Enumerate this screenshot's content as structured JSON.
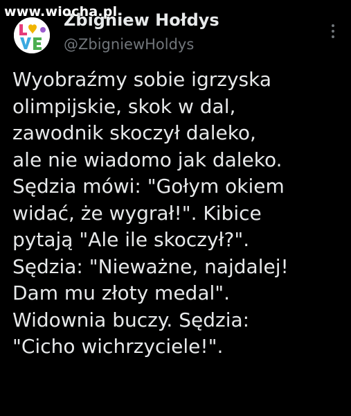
{
  "watermark": "www.wiocha.pl",
  "author": {
    "name": "Zbigniew Hołdys",
    "handle": "@ZbigniewHoldys",
    "avatar_text": "LOVE"
  },
  "menu_icon": "more-vertical-icon",
  "tweet": {
    "lines": [
      "Wyobraźmy sobie igrzyska",
      "olimpijskie, skok w dal,",
      "zawodnik skoczył daleko,",
      "ale nie wiadomo jak daleko.",
      "Sędzia mówi: \"Gołym okiem",
      "widać, że wygrał!\". Kibice",
      "pytają \"Ale ile skoczył?\".",
      "Sędzia: \"Nieważne, najdalej!",
      "Dam mu złoty medal\".",
      "Widownia buczy. Sędzia:",
      "\"Cicho wichrzyciele!\"."
    ]
  },
  "colors": {
    "background": "#000000",
    "text": "#e7e9ea",
    "secondary": "#71767b"
  }
}
